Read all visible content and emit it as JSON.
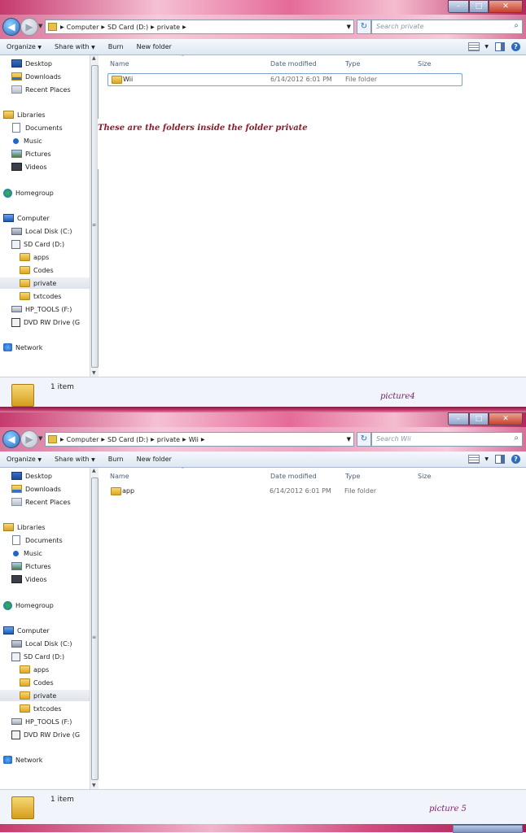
{
  "windows": [
    {
      "address": {
        "crumbs": [
          "Computer",
          "SD Card (D:)",
          "private"
        ]
      },
      "search_placeholder": "Search private",
      "toolbar": {
        "organize": "Organize",
        "share_with": "Share with",
        "burn": "Burn",
        "new_folder": "New folder"
      },
      "sidebar": {
        "items": [
          "Desktop",
          "Downloads",
          "Recent Places",
          "Libraries",
          "Documents",
          "Music",
          "Pictures",
          "Videos",
          "Homegroup",
          "Computer",
          "Local Disk (C:)",
          "SD Card (D:)",
          "apps",
          "Codes",
          "private",
          "txtcodes",
          "HP_TOOLS (F:)",
          "DVD RW Drive (G",
          "Network"
        ]
      },
      "columns": {
        "name": "Name",
        "date": "Date modified",
        "type": "Type",
        "size": "Size"
      },
      "rows": [
        {
          "name": "Wii",
          "date": "6/14/2012 6:01 PM",
          "type": "File folder"
        }
      ],
      "annotation": "These are the folders inside the folder private",
      "status_count": "1 item",
      "caption": "picture4"
    },
    {
      "address": {
        "crumbs": [
          "Computer",
          "SD Card (D:)",
          "private",
          "Wii"
        ]
      },
      "search_placeholder": "Search Wii",
      "toolbar": {
        "organize": "Organize",
        "share_with": "Share with",
        "burn": "Burn",
        "new_folder": "New folder"
      },
      "sidebar": {
        "items": [
          "Desktop",
          "Downloads",
          "Recent Places",
          "Libraries",
          "Documents",
          "Music",
          "Pictures",
          "Videos",
          "Homegroup",
          "Computer",
          "Local Disk (C:)",
          "SD Card (D:)",
          "apps",
          "Codes",
          "private",
          "txtcodes",
          "HP_TOOLS (F:)",
          "DVD RW Drive (G",
          "Network"
        ]
      },
      "columns": {
        "name": "Name",
        "date": "Date modified",
        "type": "Type",
        "size": "Size"
      },
      "rows": [
        {
          "name": "app",
          "date": "6/14/2012 6:01 PM",
          "type": "File folder"
        }
      ],
      "annotation": "",
      "status_count": "1 item",
      "caption": "picture 5"
    }
  ],
  "icons": {
    "sidebar": [
      "desktop-icon",
      "downloads-icon",
      "recent-places-icon",
      "libraries-icon",
      "documents-icon",
      "music-icon",
      "pictures-icon",
      "videos-icon",
      "homegroup-icon",
      "computer-icon",
      "local-disk-icon",
      "sd-card-icon",
      "folder-icon",
      "folder-icon",
      "folder-icon",
      "folder-icon",
      "hp-tools-drive-icon",
      "dvd-drive-icon",
      "network-icon"
    ]
  },
  "colors": {
    "title_pink": "#e56a98",
    "selection_border": "#7da2ce",
    "annotation_red": "#8a1d2c",
    "caption_purple": "#7a1d6a"
  }
}
